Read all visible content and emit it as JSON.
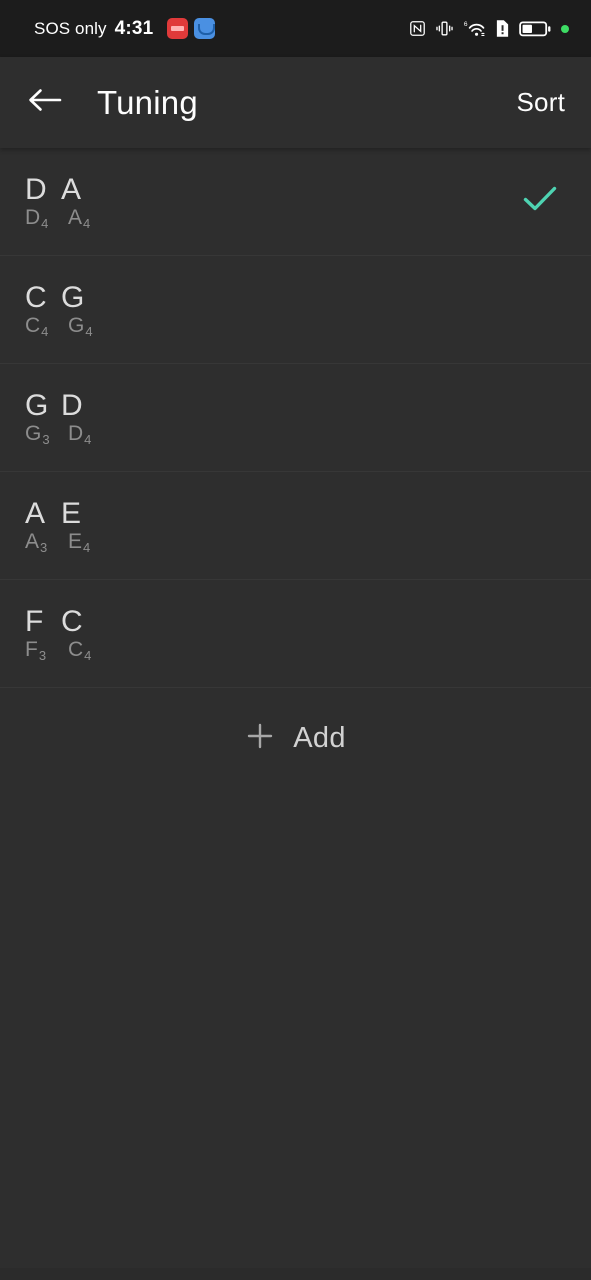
{
  "status_bar": {
    "carrier": "SOS only",
    "time": "4:31",
    "notifications": [
      {
        "name": "red-app-notification-icon",
        "color": "#e03a3a"
      },
      {
        "name": "blue-app-notification-icon",
        "color": "#4a90e2"
      }
    ],
    "icons": [
      {
        "name": "nfc-icon"
      },
      {
        "name": "vibrate-icon"
      },
      {
        "name": "wifi-6-icon"
      },
      {
        "name": "sim-alert-icon"
      },
      {
        "name": "battery-icon",
        "level": 40
      },
      {
        "name": "privacy-indicator-dot",
        "color": "#3ddc64"
      }
    ]
  },
  "header": {
    "back_icon": "arrow-left-icon",
    "title": "Tuning",
    "sort_label": "Sort"
  },
  "list": {
    "items": [
      {
        "notes": [
          "D",
          "A"
        ],
        "pitches": [
          {
            "note": "D",
            "octave": "4"
          },
          {
            "note": "A",
            "octave": "4"
          }
        ],
        "selected": true
      },
      {
        "notes": [
          "C",
          "G"
        ],
        "pitches": [
          {
            "note": "C",
            "octave": "4"
          },
          {
            "note": "G",
            "octave": "4"
          }
        ],
        "selected": false
      },
      {
        "notes": [
          "G",
          "D"
        ],
        "pitches": [
          {
            "note": "G",
            "octave": "3"
          },
          {
            "note": "D",
            "octave": "4"
          }
        ],
        "selected": false
      },
      {
        "notes": [
          "A",
          "E"
        ],
        "pitches": [
          {
            "note": "A",
            "octave": "3"
          },
          {
            "note": "E",
            "octave": "4"
          }
        ],
        "selected": false
      },
      {
        "notes": [
          "F",
          "C"
        ],
        "pitches": [
          {
            "note": "F",
            "octave": "3"
          },
          {
            "note": "C",
            "octave": "4"
          }
        ],
        "selected": false
      }
    ]
  },
  "add_button": {
    "icon": "plus-icon",
    "label": "Add"
  },
  "colors": {
    "background": "#2e2e2e",
    "status_bar_background": "#1c1c1c",
    "divider": "#373737",
    "check_accent": "#4ed3b2",
    "primary_text": "#dcdcdc",
    "secondary_text": "#8d8d8d"
  }
}
